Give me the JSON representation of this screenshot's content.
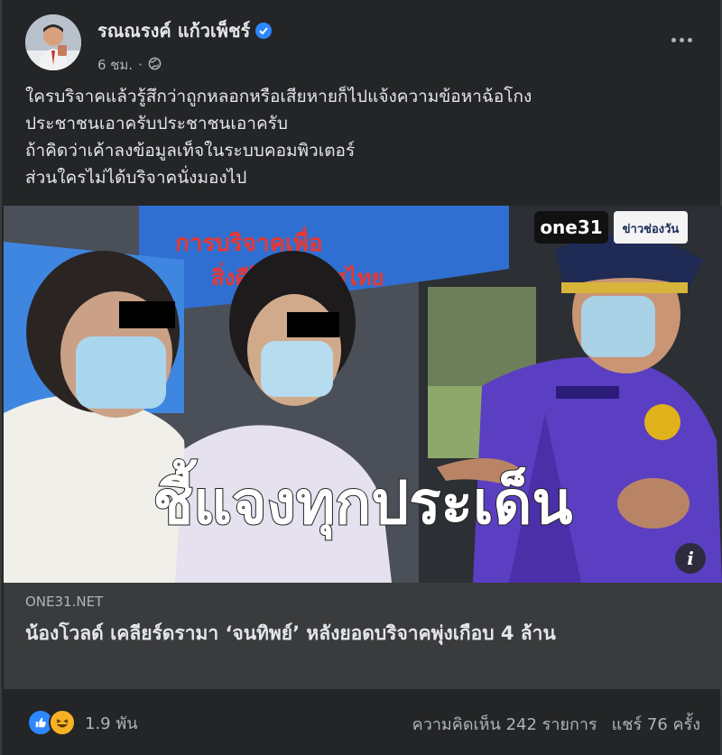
{
  "post": {
    "author": "รณณรงค์ แก้วเพ็ชร์",
    "time": "6 ชม.",
    "lines": [
      "ใครบริจาคแล้วรู้สึกว่าถูกหลอกหรือเสียหายก็ไปแจ้งความข้อหาฉ้อโกง",
      "ประชาชนเอาครับประชาชนเอาครับ",
      "ถ้าคิดว่าเค้าลงข้อมูลเท็จในระบบคอมพิวเตอร์",
      "ส่วนใครไม่ได้บริจาคนั่งมองไป"
    ]
  },
  "media": {
    "caption": "ชี้แจงทุกประเด็น",
    "channel_logo": "one31",
    "channel_tag": "ข่าวช่องวัน",
    "banner_text_1": "การบริจาคเพื่อ",
    "banner_text_2": "สิ่งดีให้ประเทศไทย",
    "info_label": "i"
  },
  "link": {
    "domain": "ONE31.NET",
    "headline": "น้องโวลด์ เคลียร์ดรามา ‘จนทิพย์’ หลังยอดบริจาคพุ่งเกือบ 4 ล้าน"
  },
  "footer": {
    "reaction_count": "1.9 พัน",
    "comments": "ความคิดเห็น 242 รายการ",
    "shares": "แชร์ 76 ครั้ง"
  },
  "icons": {
    "verified": "verified-badge-icon",
    "privacy": "globe-icon",
    "more": "more-options-icon",
    "like": "like-reaction-icon",
    "haha": "haha-reaction-icon",
    "info": "info-icon"
  },
  "colors": {
    "accent": "#2d88ff",
    "card": "#242526",
    "link_bg": "#3a3b3c"
  }
}
